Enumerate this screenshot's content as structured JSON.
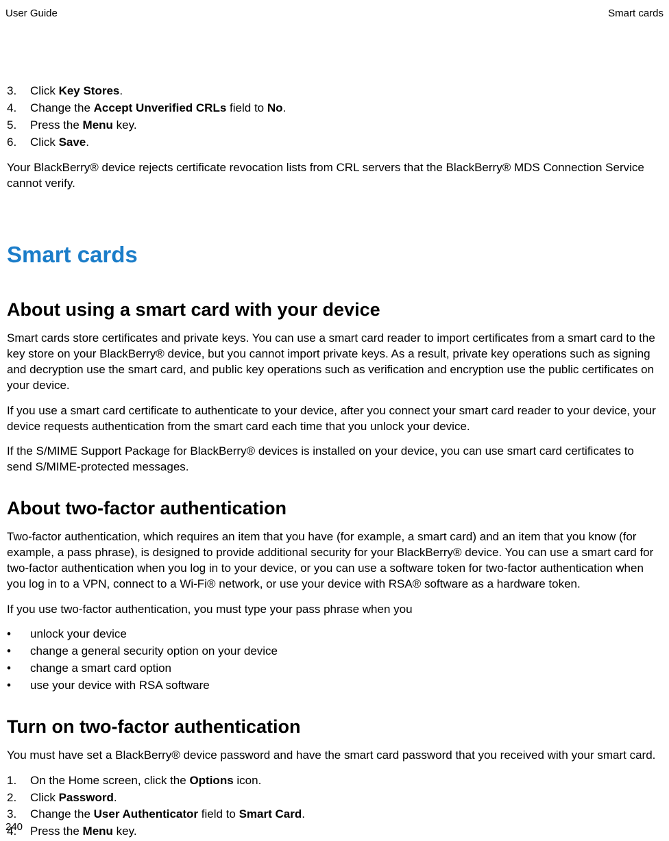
{
  "header": {
    "left": "User Guide",
    "right": "Smart cards"
  },
  "topSteps": [
    {
      "n": "3.",
      "pre": "Click ",
      "b1": "Key Stores",
      "mid": ".",
      "b2": "",
      "post": ""
    },
    {
      "n": "4.",
      "pre": "Change the ",
      "b1": "Accept Unverified CRLs",
      "mid": " field to ",
      "b2": "No",
      "post": "."
    },
    {
      "n": "5.",
      "pre": "Press the ",
      "b1": "Menu",
      "mid": " key.",
      "b2": "",
      "post": ""
    },
    {
      "n": "6.",
      "pre": "Click ",
      "b1": "Save",
      "mid": ".",
      "b2": "",
      "post": ""
    }
  ],
  "topNote": "Your BlackBerry® device rejects certificate revocation lists from CRL servers that the BlackBerry® MDS Connection Service cannot verify.",
  "h1": "Smart cards",
  "sec1": {
    "title": "About using a smart card with your device",
    "p1": "Smart cards store certificates and private keys. You can use a smart card reader to import certificates from a smart card to the key store on your BlackBerry® device, but you cannot import private keys. As a result, private key operations such as signing and decryption use the smart card, and public key operations such as verification and encryption use the public certificates on your device.",
    "p2": "If you use a smart card certificate to authenticate to your device, after you connect your smart card reader to your device, your device requests authentication from the smart card each time that you unlock your device.",
    "p3": "If the S/MIME Support Package for BlackBerry® devices is installed on your device, you can use smart card certificates to send S/MIME-protected messages."
  },
  "sec2": {
    "title": "About two-factor authentication",
    "p1": "Two-factor authentication, which requires an item that you have (for example, a smart card) and an item that you know (for example, a pass phrase), is designed to provide additional security for your BlackBerry® device. You can use a smart card for two-factor authentication when you log in to your device, or you can use a software token for two-factor authentication when you log in to a VPN, connect to a Wi-Fi® network, or use your device with RSA® software as a hardware token.",
    "p2": "If you use two-factor authentication, you must type your pass phrase when you",
    "bullets": [
      "unlock your device",
      "change a general security option on your device",
      "change a smart card option",
      "use your device with RSA software"
    ]
  },
  "sec3": {
    "title": "Turn on two-factor authentication",
    "p1": "You must have set a BlackBerry® device password and have the smart card password that you received with your smart card.",
    "steps": [
      {
        "n": "1.",
        "pre": "On the Home screen, click the ",
        "b1": "Options",
        "mid": " icon.",
        "b2": "",
        "post": ""
      },
      {
        "n": "2.",
        "pre": "Click ",
        "b1": "Password",
        "mid": ".",
        "b2": "",
        "post": ""
      },
      {
        "n": "3.",
        "pre": "Change the ",
        "b1": "User Authenticator",
        "mid": " field to ",
        "b2": "Smart Card",
        "post": "."
      },
      {
        "n": "4.",
        "pre": "Press the ",
        "b1": "Menu",
        "mid": " key.",
        "b2": "",
        "post": ""
      }
    ]
  },
  "pageNumber": "240"
}
